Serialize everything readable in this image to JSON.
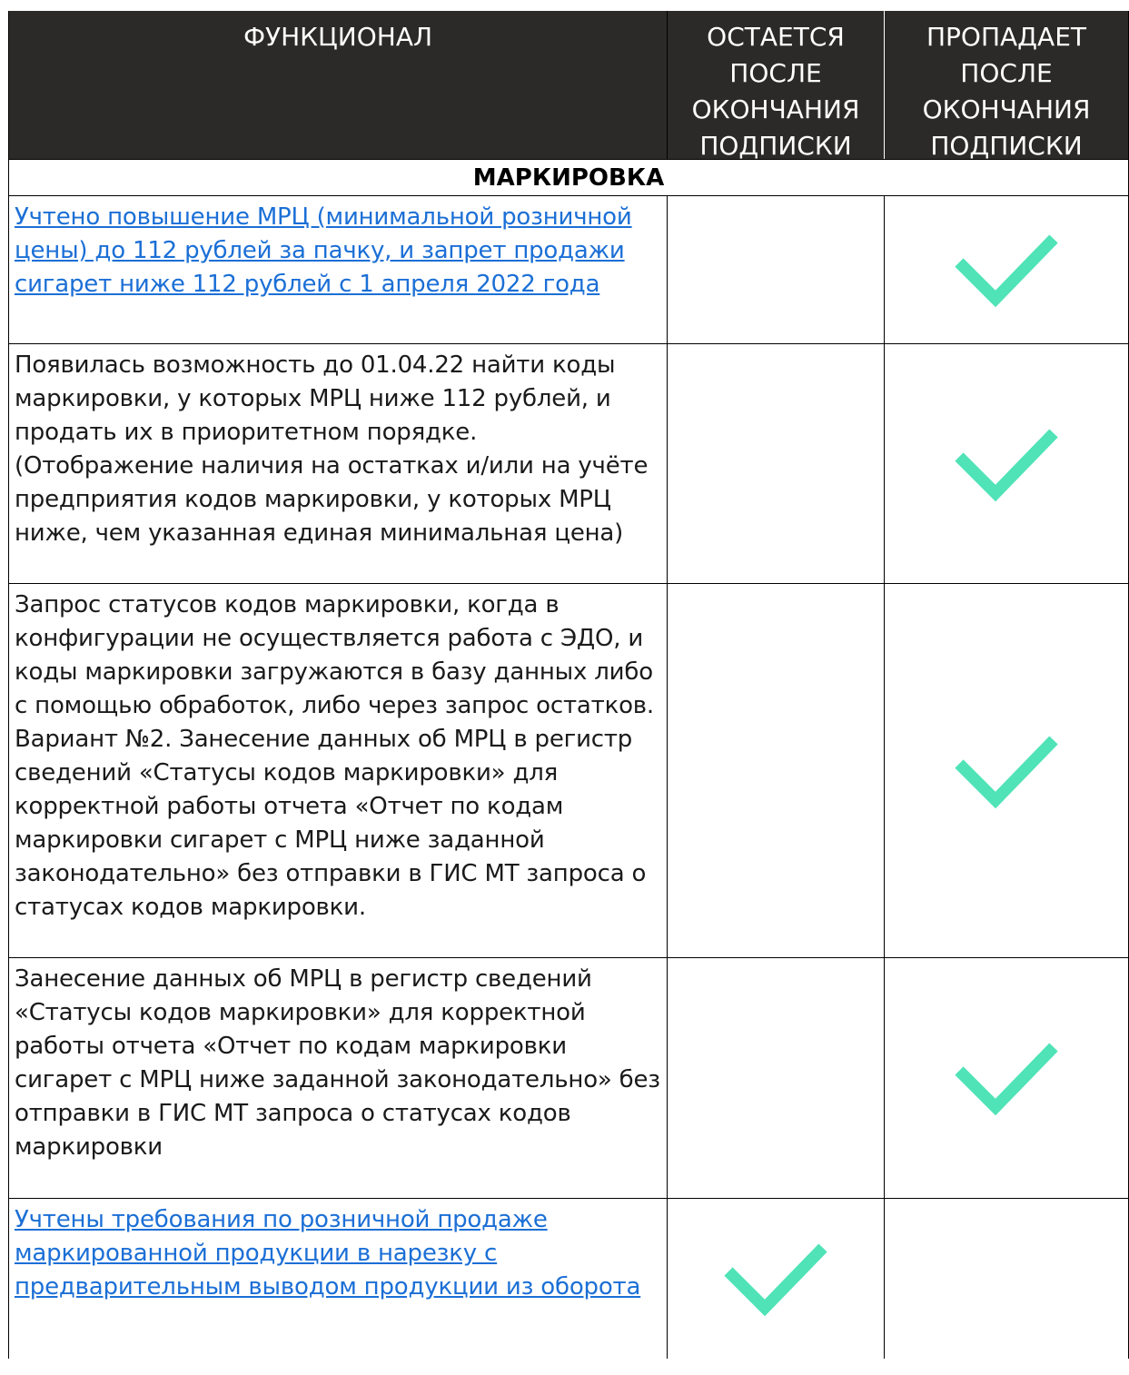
{
  "header": {
    "col1": "ФУНКЦИОНАЛ",
    "col2_lines": [
      "ОСТАЕТСЯ",
      "ПОСЛЕ",
      "ОКОНЧАНИЯ",
      "ПОДПИСКИ"
    ],
    "col3_lines": [
      "ПРОПАДАЕТ",
      "ПОСЛЕ",
      "ОКОНЧАНИЯ",
      "ПОДПИСКИ"
    ]
  },
  "section": {
    "title": "МАРКИРОВКА"
  },
  "rows": [
    {
      "text": "Учтено повышение МРЦ (минимальной розничной цены) до 112 рублей за пачку, и запрет продажи сигарет ниже 112 рублей с 1 апреля 2022 года",
      "is_link": true,
      "remains": false,
      "disappears": true
    },
    {
      "text": "Появилась возможность до 01.04.22 найти коды маркировки, у которых МРЦ ниже 112 рублей, и продать их в приоритетном порядке. (Отображение наличия на остатках и/или на учёте предприятия кодов маркировки, у которых МРЦ ниже, чем указанная единая минимальная цена)",
      "is_link": false,
      "remains": false,
      "disappears": true
    },
    {
      "text": "Запрос статусов кодов маркировки, когда в конфигурации не осуществляется работа с ЭДО, и коды маркировки загружаются в базу данных либо с помощью обработок, либо через запрос остатков. Вариант №2. Занесение данных об МРЦ в регистр сведений «Статусы кодов маркировки» для корректной работы отчета «Отчет по кодам маркировки сигарет с МРЦ ниже заданной законодательно» без отправки в ГИС МТ запроса о статусах кодов маркировки.",
      "is_link": false,
      "remains": false,
      "disappears": true
    },
    {
      "text": "Занесение данных об МРЦ в регистр сведений «Статусы кодов маркировки» для корректной работы отчета «Отчет по кодам маркировки сигарет с МРЦ ниже заданной законодательно» без отправки в ГИС МТ запроса о статусах кодов маркировки",
      "is_link": false,
      "remains": false,
      "disappears": true
    },
    {
      "text": "Учтены требования по розничной продаже маркированной продукции в нарезку с предварительным выводом продукции из оборота",
      "is_link": true,
      "remains": true,
      "disappears": false
    }
  ],
  "colors": {
    "header_bg": "#2b2a29",
    "link": "#1b6fd6",
    "check": "#4fe3b7"
  },
  "icons": {
    "check": "checkmark-icon"
  }
}
